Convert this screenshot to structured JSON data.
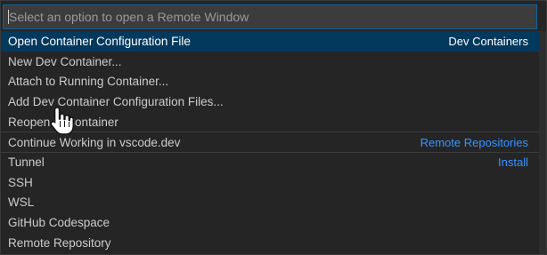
{
  "search": {
    "placeholder": "Select an option to open a Remote Window"
  },
  "items": [
    {
      "label": "Open Container Configuration File",
      "detail": "Dev Containers",
      "selected": true
    },
    {
      "label": "New Dev Container...",
      "detail": ""
    },
    {
      "label": "Attach to Running Container...",
      "detail": ""
    },
    {
      "label": "Add Dev Container Configuration Files...",
      "detail": ""
    },
    {
      "label": "Reopen in Container",
      "detail": ""
    },
    {
      "label": "Continue Working in vscode.dev",
      "detail": "Remote Repositories"
    },
    {
      "label": "Tunnel",
      "detail": "Install"
    },
    {
      "label": "SSH",
      "detail": ""
    },
    {
      "label": "WSL",
      "detail": ""
    },
    {
      "label": "GitHub Codespace",
      "detail": ""
    },
    {
      "label": "Remote Repository",
      "detail": ""
    }
  ],
  "colors": {
    "selection": "#04395e",
    "link": "#3794ff",
    "focus_border": "#0e639c"
  },
  "icons": {
    "cursor": "hand-pointer-icon"
  }
}
